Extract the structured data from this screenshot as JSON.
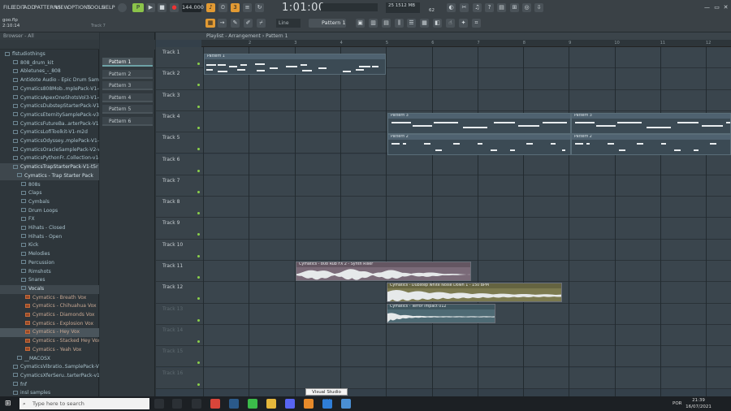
{
  "menu": [
    "FILE",
    "EDIT",
    "ADD",
    "PATTERNS",
    "VIEW",
    "OPTIONS",
    "TOOLS",
    "HELP"
  ],
  "project": {
    "file": "goo.flp",
    "time": "2:10:14",
    "hint": "Track 7"
  },
  "transport": {
    "tempo": "144.000",
    "time": "1:01:00",
    "cpu": "25",
    "ram": "1512 MB",
    "voices": "62"
  },
  "pattern_selector": "Pattern 1",
  "snap": "Line",
  "browser": {
    "title": "Browser - All",
    "items": [
      {
        "label": "flstudiothings",
        "type": "folder"
      },
      {
        "label": "808_drum_kit",
        "type": "folder"
      },
      {
        "label": "Abletunes_-_808",
        "type": "folder"
      },
      {
        "label": "Antidote Audio - Epic Drum Samples",
        "type": "folder"
      },
      {
        "label": "Cymatics808Mob..mplePack-V1-g9m",
        "type": "folder"
      },
      {
        "label": "CymaticsApexOneShotsVol3-V1-g5c",
        "type": "folder"
      },
      {
        "label": "CymaticsDubstepStarterPack-V1-d4t",
        "type": "folder"
      },
      {
        "label": "CymaticsEternitySamplePack-v3-j8i",
        "type": "folder"
      },
      {
        "label": "CymaticsFutureBa..arterPack-V1-u3w",
        "type": "folder"
      },
      {
        "label": "CymaticsLofiToolkit-V1-m2d",
        "type": "folder"
      },
      {
        "label": "CymaticsOdyssey..mplePack-V1-u0m",
        "type": "folder"
      },
      {
        "label": "CymaticsOracleSamplePack-V2-v3x",
        "type": "folder"
      },
      {
        "label": "CymaticsPythonFr..Collection-v1-p6u",
        "type": "folder"
      },
      {
        "label": "CymaticsTrapStarterPack-V1-t5r",
        "type": "folder",
        "sel": true
      },
      {
        "label": "Cymatics - Trap Starter Pack",
        "type": "folder",
        "sel": true
      },
      {
        "label": "808s",
        "type": "folder"
      },
      {
        "label": "Claps",
        "type": "folder"
      },
      {
        "label": "Cymbals",
        "type": "folder"
      },
      {
        "label": "Drum Loops",
        "type": "folder"
      },
      {
        "label": "FX",
        "type": "folder"
      },
      {
        "label": "Hihats - Closed",
        "type": "folder"
      },
      {
        "label": "Hihats - Open",
        "type": "folder"
      },
      {
        "label": "Kick",
        "type": "folder"
      },
      {
        "label": "Melodies",
        "type": "folder"
      },
      {
        "label": "Percussion",
        "type": "folder"
      },
      {
        "label": "Rimshots",
        "type": "folder"
      },
      {
        "label": "Snares",
        "type": "folder"
      },
      {
        "label": "Vocals",
        "type": "folder",
        "sel": true
      },
      {
        "label": "Cymatics - Breath Vox",
        "type": "wav"
      },
      {
        "label": "Cymatics - Chihuahua Vox",
        "type": "wav"
      },
      {
        "label": "Cymatics - Diamonds Vox",
        "type": "wav"
      },
      {
        "label": "Cymatics - Explosion Vox",
        "type": "wav"
      },
      {
        "label": "Cymatics - Hey Vox",
        "type": "wav",
        "hl": true
      },
      {
        "label": "Cymatics - Stacked Hey Vox",
        "type": "wav"
      },
      {
        "label": "Cymatics - Yeah Vox",
        "type": "wav"
      },
      {
        "label": "__MACOSX",
        "type": "folder"
      },
      {
        "label": "CymaticsVibratio..SamplePack-V1-h8i",
        "type": "folder"
      },
      {
        "label": "CymaticsXferSeru..tarterPack-v1-g7r",
        "type": "folder"
      },
      {
        "label": "fnf",
        "type": "folder"
      },
      {
        "label": "insl samples",
        "type": "folder"
      }
    ]
  },
  "patterns": [
    "Pattern 1",
    "Pattern 2",
    "Pattern 3",
    "Pattern 4",
    "Pattern 5",
    "Pattern 6"
  ],
  "playlist": {
    "title": "Playlist - Arrangement",
    "current": "Pattern 1",
    "ruler": [
      "2",
      "3",
      "4",
      "5",
      "6",
      "7",
      "8",
      "9",
      "10",
      "11",
      "12"
    ],
    "tracks": [
      "Track 1",
      "Track 2",
      "Track 3",
      "Track 4",
      "Track 5",
      "Track 6",
      "Track 7",
      "Track 8",
      "Track 9",
      "Track 10",
      "Track 11",
      "Track 12",
      "Track 13",
      "Track 14",
      "Track 15",
      "Track 16"
    ],
    "clips": {
      "p1": "Pattern 1",
      "p3a": "Pattern 3",
      "p3b": "Pattern 3",
      "p2a": "Pattern 2",
      "p2b": "Pattern 2",
      "a1": "Cymatics - 808 Rub FX 2 - Synth Riser",
      "a2": "Cymatics - Dubstep white Noise Down 1 - 150 BPM",
      "a3": "Cymatics - Terror Impact 012"
    }
  },
  "taskbar": {
    "search": "Search",
    "search_placeholder": "Type here to search",
    "tooltip": "Visual Studio Code",
    "lang": "POR",
    "time": "21:39",
    "date": "16/07/2021"
  },
  "colors": {
    "accent": "#e29a33",
    "clip": "#3b4a54",
    "audio1": "#7a6a78",
    "audio2": "#7c7a50",
    "audio3": "#4e6a74"
  }
}
